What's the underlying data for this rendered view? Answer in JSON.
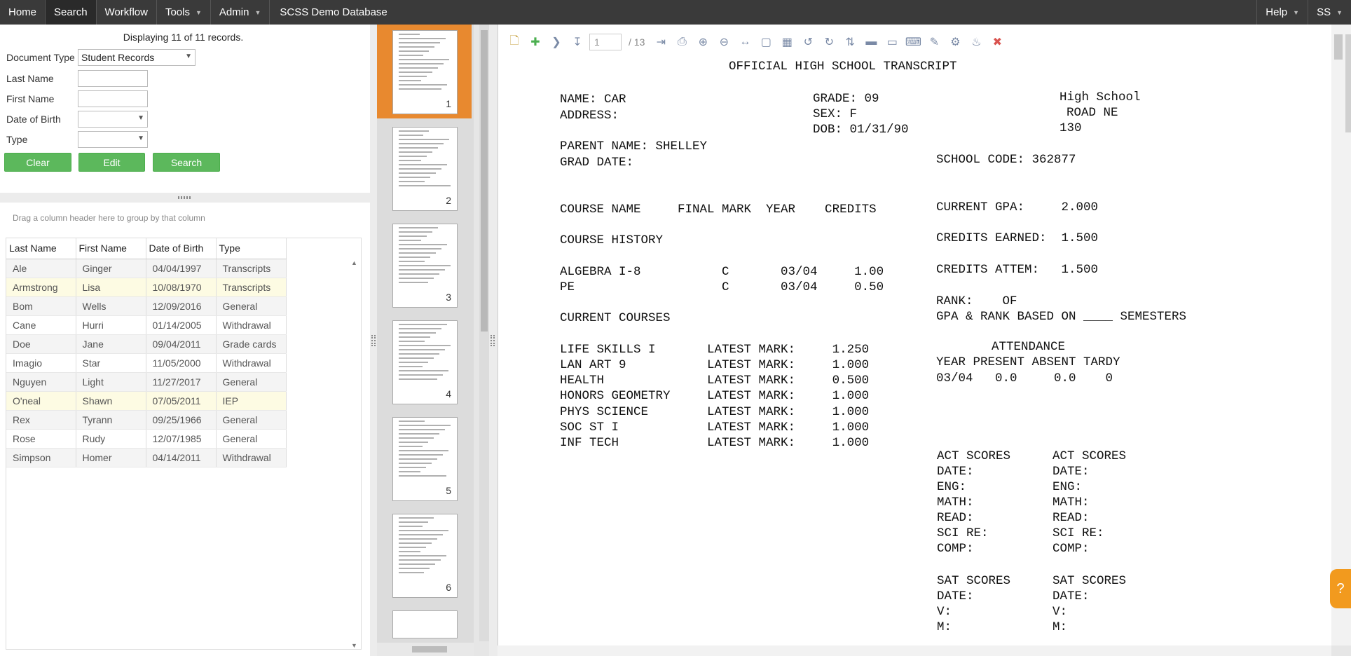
{
  "nav": {
    "home": "Home",
    "search": "Search",
    "workflow": "Workflow",
    "tools": "Tools",
    "admin": "Admin",
    "db_title": "SCSS Demo Database",
    "help": "Help",
    "user": "SS"
  },
  "search": {
    "displaying": "Displaying 11 of 11 records.",
    "doc_type_label": "Document Type",
    "doc_type_value": "Student Records",
    "last_name_label": "Last Name",
    "first_name_label": "First Name",
    "dob_label": "Date of Birth",
    "type_label": "Type",
    "clear": "Clear",
    "edit": "Edit",
    "search": "Search"
  },
  "grid": {
    "group_hint": "Drag a column header here to group by that column",
    "columns": [
      "Last Name",
      "First Name",
      "Date of Birth",
      "Type"
    ],
    "rows": [
      [
        "Ale",
        "Ginger",
        "04/04/1997",
        "Transcripts"
      ],
      [
        "Armstrong",
        "Lisa",
        "10/08/1970",
        "Transcripts"
      ],
      [
        "Bom",
        "Wells",
        "12/09/2016",
        "General"
      ],
      [
        "Cane",
        "Hurri",
        "01/14/2005",
        "Withdrawal"
      ],
      [
        "Doe",
        "Jane",
        "09/04/2011",
        "Grade cards"
      ],
      [
        "Imagio",
        "Star",
        "11/05/2000",
        "Withdrawal"
      ],
      [
        "Nguyen",
        "Light",
        "11/27/2017",
        "General"
      ],
      [
        "O'neal",
        "Shawn",
        "07/05/2011",
        "IEP"
      ],
      [
        "Rex",
        "Tyrann",
        "09/25/1966",
        "General"
      ],
      [
        "Rose",
        "Rudy",
        "12/07/1985",
        "General"
      ],
      [
        "Simpson",
        "Homer",
        "04/14/2011",
        "Withdrawal"
      ]
    ]
  },
  "thumbnails": [
    "1",
    "2",
    "3",
    "4",
    "5",
    "6"
  ],
  "viewer": {
    "page_current": "1",
    "page_total": "/ 13"
  },
  "doc": {
    "title": "OFFICIAL HIGH SCHOOL TRANSCRIPT",
    "name": "NAME: CAR",
    "address": "ADDRESS:",
    "grade": "GRADE: 09",
    "sex": "SEX: F",
    "dob": "DOB: 01/31/90",
    "school": "High School",
    "road": "ROAD NE",
    "num": "130",
    "parent": "PARENT NAME: SHELLEY",
    "grad_date": "GRAD DATE:",
    "school_code": "SCHOOL CODE: 362877",
    "col_header": "COURSE NAME     FINAL MARK  YEAR    CREDITS",
    "current_gpa": "CURRENT GPA:     2.000",
    "course_history": "COURSE HISTORY",
    "credits_earned": "CREDITS EARNED:  1.500",
    "hist1": "ALGEBRA I-8           C       03/04     1.00",
    "hist2": "PE                    C       03/04     0.50",
    "credits_attem": "CREDITS ATTEM:   1.500",
    "rank": "RANK:    OF",
    "gpa_rank": "GPA & RANK BASED ON ____ SEMESTERS",
    "current_courses": "CURRENT COURSES",
    "cur1": "LIFE SKILLS I       LATEST MARK:     1.250",
    "cur2": "LAN ART 9           LATEST MARK:     1.000",
    "cur3": "HEALTH              LATEST MARK:     0.500",
    "cur4": "HONORS GEOMETRY     LATEST MARK:     1.000",
    "cur5": "PHYS SCIENCE        LATEST MARK:     1.000",
    "cur6": "SOC ST I            LATEST MARK:     1.000",
    "cur7": "INF TECH            LATEST MARK:     1.000",
    "attendance": "ATTENDANCE",
    "att_header": "YEAR PRESENT ABSENT TARDY",
    "att_row": "03/04   0.0     0.0    0",
    "act_a": [
      "ACT SCORES",
      "DATE:",
      "ENG:",
      "MATH:",
      "READ:",
      "SCI RE:",
      "COMP:"
    ],
    "act_b": [
      "ACT SCORES",
      "DATE:",
      "ENG:",
      "MATH:",
      "READ:",
      "SCI RE:",
      "COMP:"
    ],
    "sat_a": [
      "SAT SCORES",
      "DATE:",
      "V:",
      "M:"
    ],
    "sat_b": [
      "SAT SCORES",
      "DATE:",
      "V:",
      "M:"
    ]
  },
  "help_badge": "?"
}
